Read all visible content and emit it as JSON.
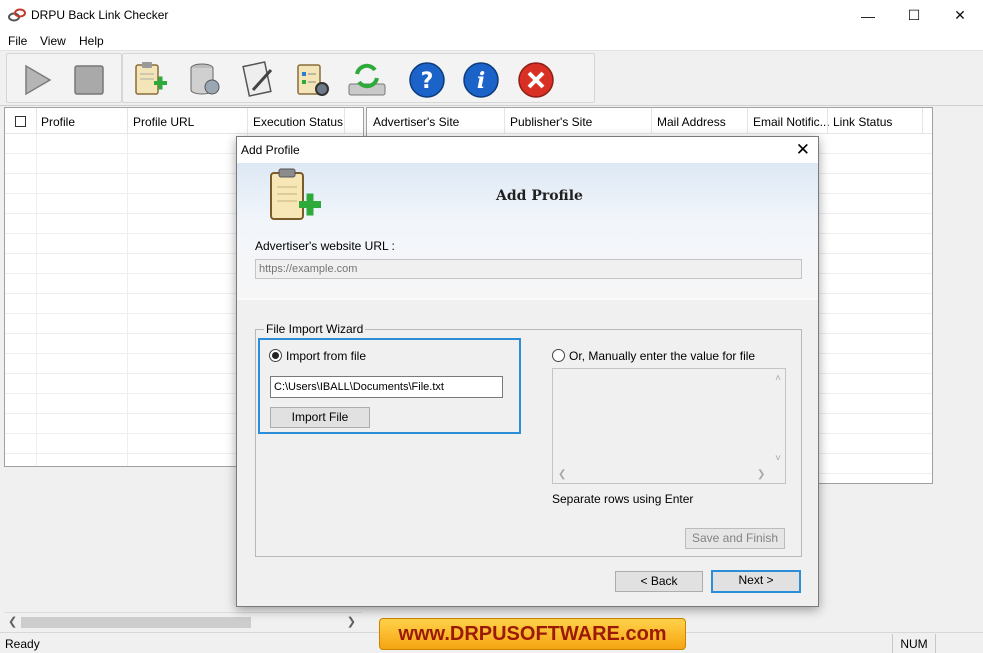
{
  "window": {
    "title": "DRPU Back Link Checker",
    "minimize": "—",
    "maximize": "☐",
    "close": "✕"
  },
  "menu": [
    "File",
    "View",
    "Help"
  ],
  "toolbar": [
    {
      "name": "start-icon"
    },
    {
      "name": "stop-icon"
    },
    {
      "name": "add-profile-icon"
    },
    {
      "name": "database-icon"
    },
    {
      "name": "report-icon"
    },
    {
      "name": "settings-icon"
    },
    {
      "name": "update-icon"
    },
    {
      "name": "help-icon"
    },
    {
      "name": "about-icon"
    },
    {
      "name": "exit-icon"
    }
  ],
  "left_grid": {
    "columns": [
      "Profile",
      "Profile URL",
      "Execution Status"
    ]
  },
  "right_grid": {
    "columns": [
      "Advertiser's Site",
      "Publisher's Site",
      "Mail Address",
      "Email Notific...",
      "Link Status"
    ]
  },
  "statusbar": {
    "status": "Ready",
    "num": "NUM"
  },
  "banner": "www.DRPUSOFTWARE.com",
  "dialog": {
    "title": "Add Profile",
    "close": "✕",
    "header": "Add Profile",
    "url_label": "Advertiser's website URL :",
    "url_placeholder": "https://example.com",
    "wizard_title": "File Import Wizard",
    "import_radio": "Import from file",
    "file_path": "C:\\Users\\IBALL\\Documents\\File.txt",
    "import_button": "Import File",
    "manual_radio": "Or, Manually enter the value for file",
    "separate_hint": "Separate rows using Enter",
    "save_button": "Save and Finish",
    "back_button": "< Back",
    "next_button": "Next >"
  }
}
